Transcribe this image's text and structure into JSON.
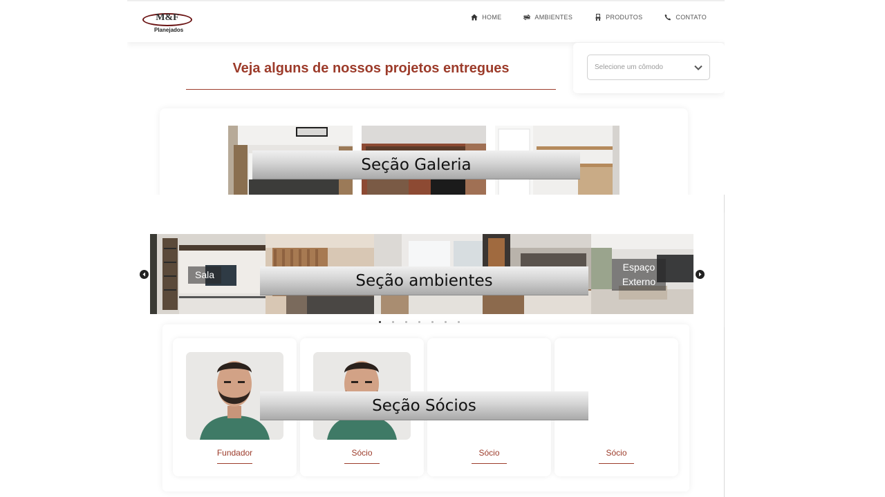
{
  "navbar": {
    "logo": {
      "mark": "M&F",
      "subtitle": "Planejados"
    },
    "items": [
      {
        "label": "HOME",
        "icon": "home-icon"
      },
      {
        "label": "AMBIENTES",
        "icon": "arrows-icon"
      },
      {
        "label": "PRODUTOS",
        "icon": "chair-icon"
      },
      {
        "label": "CONTATO",
        "icon": "phone-icon"
      }
    ]
  },
  "gallery": {
    "title": "Veja alguns de nossos projetos entregues",
    "select_placeholder": "Selecione um cômodo"
  },
  "ambientes": {
    "slides": [
      {
        "label": "Sala"
      },
      {
        "label": ""
      },
      {
        "label": ""
      },
      {
        "label": ""
      },
      {
        "label": "Espaço Externo",
        "line1": "Espaço",
        "line2": "Externo"
      }
    ],
    "dots": 7,
    "active_dot": 1
  },
  "partners": [
    {
      "role": "Fundador"
    },
    {
      "role": "Sócio"
    },
    {
      "role": "Sócio"
    },
    {
      "role": "Sócio"
    }
  ],
  "annotations": {
    "gallery": "Seção Galeria",
    "ambientes": "Seção ambientes",
    "socios": "Seção Sócios"
  },
  "colors": {
    "accent": "#9c3b2a",
    "banner": "#c4c4c4"
  }
}
